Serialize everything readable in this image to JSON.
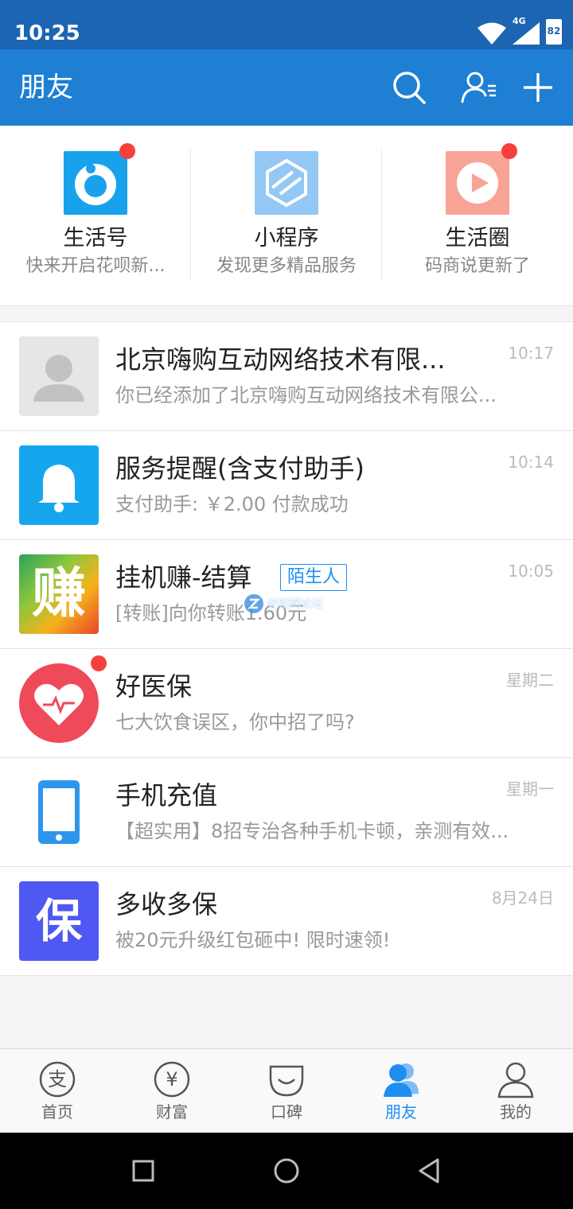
{
  "status": {
    "time": "10:25",
    "network": "4G",
    "battery": "82"
  },
  "header": {
    "title": "朋友"
  },
  "quick": [
    {
      "title": "生活号",
      "subtitle": "快来开启花呗新...",
      "has_dot": true
    },
    {
      "title": "小程序",
      "subtitle": "发现更多精品服务",
      "has_dot": false
    },
    {
      "title": "生活圈",
      "subtitle": "码商说更新了",
      "has_dot": true
    }
  ],
  "messages": [
    {
      "title": "北京嗨购互动网络技术有限...",
      "subtitle": "你已经添加了北京嗨购互动网络技术有限公...",
      "time": "10:17"
    },
    {
      "title": "服务提醒(含支付助手)",
      "subtitle": "支付助手: ￥2.00 付款成功",
      "time": "10:14"
    },
    {
      "title": "挂机赚-结算",
      "badge": "陌生人",
      "subtitle": "[转账]向你转账1.60元",
      "time": "10:05",
      "avatar_char": "赚"
    },
    {
      "title": "好医保",
      "subtitle": "七大饮食误区，你中招了吗?",
      "time": "星期二"
    },
    {
      "title": "手机充值",
      "subtitle": "【超实用】8招专治各种手机卡顿，亲测有效...",
      "time": "星期一"
    },
    {
      "title": "多收多保",
      "subtitle": "被20元升级红包砸中! 限时速领!",
      "time": "8月24日",
      "avatar_char": "保"
    }
  ],
  "tabs": [
    {
      "label": "首页",
      "icon_char": "支"
    },
    {
      "label": "财富",
      "icon_char": "¥"
    },
    {
      "label": "口碑"
    },
    {
      "label": "朋友"
    },
    {
      "label": "我的"
    }
  ],
  "watermark": "好赚网论坛",
  "colors": {
    "header": "#1e7fd3",
    "status_bar": "#1c65b2",
    "accent": "#1e8ef0",
    "dot": "#f5413e"
  }
}
